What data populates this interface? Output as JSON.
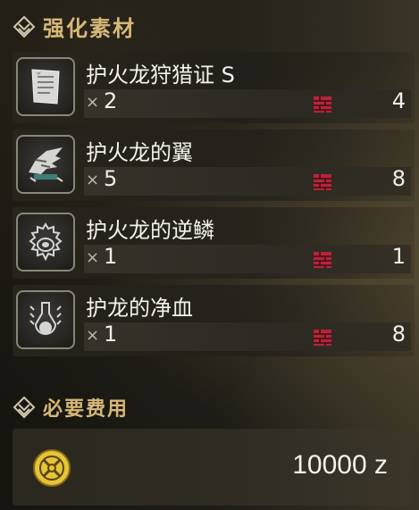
{
  "section_title": "强化素材",
  "materials": [
    {
      "name": "护火龙狩猎证 S",
      "qty_prefix": "×",
      "qty": "2",
      "owned": "4",
      "icon": "ticket-icon"
    },
    {
      "name": "护火龙的翼",
      "qty_prefix": "×",
      "qty": "5",
      "owned": "8",
      "icon": "wing-icon"
    },
    {
      "name": "护火龙的逆鳞",
      "qty_prefix": "×",
      "qty": "1",
      "owned": "1",
      "icon": "scale-icon"
    },
    {
      "name": "护龙的净血",
      "qty_prefix": "×",
      "qty": "1",
      "owned": "8",
      "icon": "blood-vial-icon"
    }
  ],
  "cost_title": "必要费用",
  "cost": {
    "value": "10000",
    "unit": "z",
    "icon": "zenny-icon"
  },
  "colors": {
    "header_gold": "#d6b877",
    "box_red": "#b3263a",
    "text": "#f2efe6"
  }
}
